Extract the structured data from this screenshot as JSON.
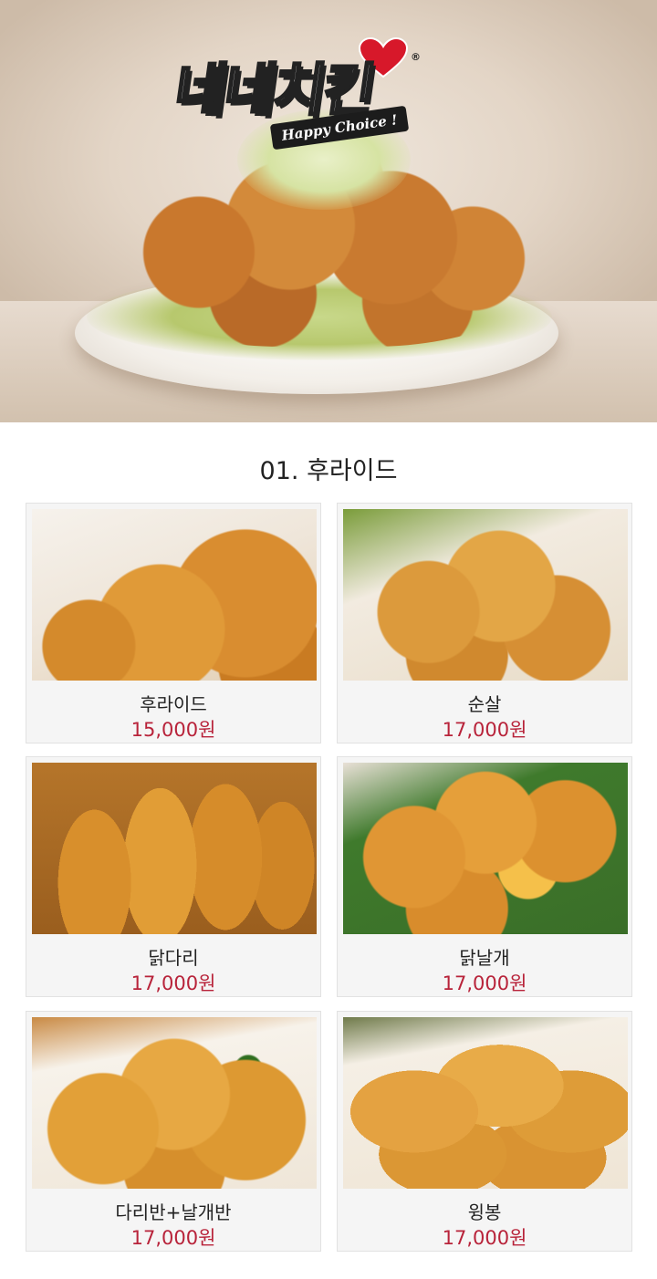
{
  "hero": {
    "logo_text": "네네치킨",
    "logo_reg": "®",
    "logo_tagline": "Happy Choice !",
    "image_alt_icon": "fried-chicken-plate-photo"
  },
  "section": {
    "title": "01. 후라이드"
  },
  "menu": [
    {
      "name": "후라이드",
      "price": "15,000원"
    },
    {
      "name": "순살",
      "price": "17,000원"
    },
    {
      "name": "닭다리",
      "price": "17,000원"
    },
    {
      "name": "닭날개",
      "price": "17,000원"
    },
    {
      "name": "다리반+날개반",
      "price": "17,000원"
    },
    {
      "name": "윙봉",
      "price": "17,000원"
    }
  ],
  "colors": {
    "price": "#b8233a",
    "logo_heart": "#d7182a",
    "card_bg": "#f5f5f5"
  }
}
